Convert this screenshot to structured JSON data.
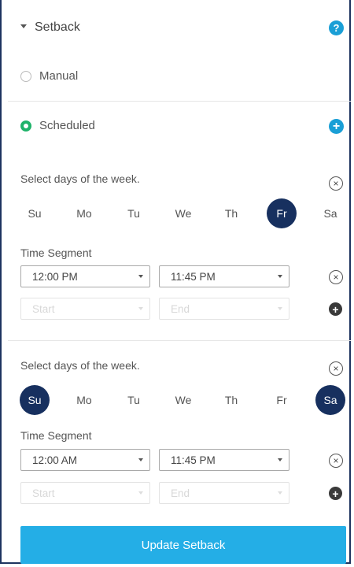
{
  "header": {
    "title": "Setback",
    "help_glyph": "?"
  },
  "modes": {
    "manual_label": "Manual",
    "scheduled_label": "Scheduled",
    "add_glyph": "+"
  },
  "schedules": [
    {
      "select_days_label": "Select days of the week.",
      "remove_glyph": "×",
      "days": [
        {
          "label": "Su",
          "selected": false
        },
        {
          "label": "Mo",
          "selected": false
        },
        {
          "label": "Tu",
          "selected": false
        },
        {
          "label": "We",
          "selected": false
        },
        {
          "label": "Th",
          "selected": false
        },
        {
          "label": "Fr",
          "selected": true
        },
        {
          "label": "Sa",
          "selected": false
        }
      ],
      "time_segment_label": "Time Segment",
      "start_value": "12:00 PM",
      "end_value": "11:45 PM",
      "start_placeholder": "Start",
      "end_placeholder": "End"
    },
    {
      "select_days_label": "Select days of the week.",
      "remove_glyph": "×",
      "days": [
        {
          "label": "Su",
          "selected": true
        },
        {
          "label": "Mo",
          "selected": false
        },
        {
          "label": "Tu",
          "selected": false
        },
        {
          "label": "We",
          "selected": false
        },
        {
          "label": "Th",
          "selected": false
        },
        {
          "label": "Fr",
          "selected": false
        },
        {
          "label": "Sa",
          "selected": true
        }
      ],
      "time_segment_label": "Time Segment",
      "start_value": "12:00 AM",
      "end_value": "11:45 PM",
      "start_placeholder": "Start",
      "end_placeholder": "End"
    }
  ],
  "segment_remove_glyph": "×",
  "segment_add_glyph": "+",
  "update_button_label": "Update Setback",
  "colors": {
    "accent": "#1a9fd6",
    "selected_day": "#17305f",
    "radio_on": "#1fb36a",
    "button": "#24aee6"
  }
}
